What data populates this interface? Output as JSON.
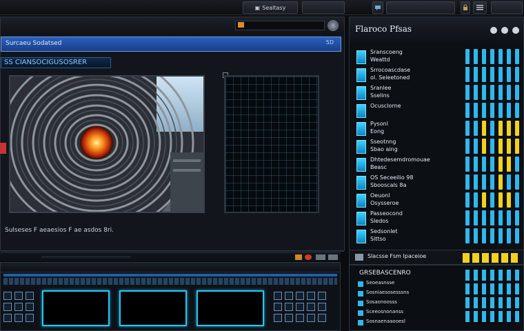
{
  "topbar": {
    "button_label": "Sealtasy"
  },
  "left_window": {
    "title": "Surcaeu Sodatsed",
    "panel_header": "SS CIANSOCIGUSOSRER",
    "status_text": "Sulseses F aeaesios F ae asdos 8ri.",
    "search_tag": "5D"
  },
  "right_panel": {
    "title": "Flaroco Pfsas",
    "items": [
      {
        "line1": "Sranscoeng",
        "line2": "Weattd"
      },
      {
        "line1": "Srrocoascdase",
        "line2": "ol. Seieetoned"
      },
      {
        "line1": "Sranlee",
        "line2": "Sselins"
      },
      {
        "line1": "Ocusclorne",
        "line2": ""
      },
      {
        "line1": "Pysonl",
        "line2": "Eong"
      },
      {
        "line1": "Sseotnng",
        "line2": "Sbao aing"
      },
      {
        "line1": "Dhtedesemdromouae",
        "line2": "Beasc"
      },
      {
        "line1": "OS Seceeilio 98",
        "line2": "Sbooscals 8a"
      },
      {
        "line1": "Oeuonl",
        "line2": "Osysseroe"
      },
      {
        "line1": "Passeocond",
        "line2": "Sledos"
      },
      {
        "line1": "Sedsonlet",
        "line2": "Sittso"
      }
    ],
    "footer": "Slacsse Fsm Ipaceioe"
  },
  "lower_right": {
    "title": "GRSEBASCENRO",
    "rows": [
      "Seoeasnsse",
      "Sosniaesosesssns",
      "Sosaonoosss",
      "Sceeosnonanss",
      "Sosnaenaaooesl"
    ]
  },
  "colors": {
    "accent": "#2fb8ee",
    "title_bar": "#2a60c0",
    "bar_yellow": "#f2d21e"
  }
}
